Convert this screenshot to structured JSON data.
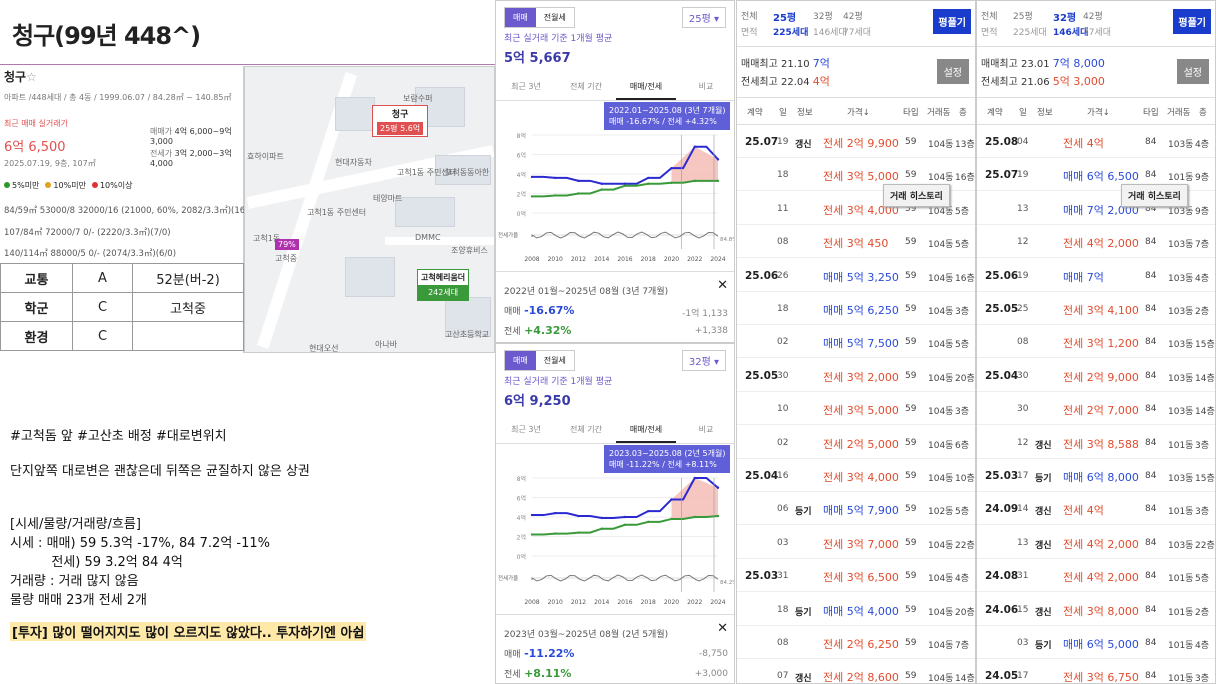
{
  "page_title": "청구(99년 448^)",
  "card": {
    "name": "청구",
    "star": "☆",
    "sub": "아파트 /448세대 / 총 4동 / 1999.06.07 / 84.28㎡ ~ 140.85㎡",
    "recent_label": "최근 매매 실거래가",
    "recent_price": "6억 6,500",
    "recent_date": "2025.07.19, 9층, 107㎡",
    "sale_label": "매매가",
    "sale_range": "4억 6,000~9억 3,000",
    "jeonse_label": "전세가",
    "jeonse_range": "3억 2,000~3억 4,000",
    "legend": [
      "5%미만",
      "10%미만",
      "10%이상"
    ],
    "legend_colors": [
      "#2a9a2a",
      "#e0a020",
      "#e03030"
    ],
    "rows": [
      "84/59㎡  53000/8  32000/16  (21000, 60%, 2082/3.3㎡)(16/2)",
      "107/84㎡  72000/7  0/-  (2220/3.3㎡)(7/0)",
      "140/114㎡  88000/5  0/-  (2074/3.3㎡)(6/0)"
    ]
  },
  "grades": [
    {
      "k": "교통",
      "g": "A",
      "v": "52분(버-2)"
    },
    {
      "k": "학군",
      "g": "C",
      "v": "고척중"
    },
    {
      "k": "환경",
      "g": "C",
      "v": ""
    }
  ],
  "map": {
    "pin_name": "청구",
    "pin_units": "25평 5.6억",
    "pin2_name": "고척헤리움더",
    "pin2_units": "242세대",
    "labels": [
      "고척1동",
      "현대자동차",
      "테양마트",
      "고척동동아한",
      "고척1동 주민센터",
      "DMMC",
      "조양휴비스",
      "고척중",
      "고산초등학교",
      "현대오선",
      "아나바",
      "보람수퍼",
      "효하이파트"
    ],
    "badge": "79%"
  },
  "notes": {
    "l1": "#고척돔 앞 #고산초 배정 #대로변위치",
    "l2": "단지앞쪽 대로변은 괜찮은데 뒤쪽은 균질하지 않은 상권",
    "l3": "[시세/물량/거래량/흐름]",
    "l4": "시세 : 매매) 59 5.3억 -17%, 84 7.2억 -11%",
    "l5": "          전세) 59 3.2억 84 4억",
    "l6": "거래량 : 거래 많지 않음",
    "l7": "물량 매매 23개 전세 2개",
    "l8": "[투자] 많이 떨어지지도 많이 오르지도 않았다.. 투자하기엔 아쉽"
  },
  "panel1": {
    "seg": [
      "매매",
      "전월세"
    ],
    "select": "25평",
    "title": "최근 실거래 기준 1개월 평균",
    "value": "5억 5,667",
    "tabs": [
      "최근 3년",
      "전체 기간",
      "매매/전세",
      "비교"
    ],
    "tip1": "2022.01~2025.08 (3년 7개월)",
    "tip2": "매매 -16.67%  /  전세 +4.32%",
    "range": "2022년 01월~2025년 08월 (3년 7개월)",
    "m_sale": "-16.67%",
    "m_sale_amt": "-1억 1,133",
    "m_rent": "+4.32%",
    "m_rent_amt": "+1,338",
    "sale_label": "매매",
    "rent_label": "전세",
    "close": "✕",
    "ylabel": "전세가율",
    "gap": "84.8%"
  },
  "panel2": {
    "seg": [
      "매매",
      "전월세"
    ],
    "select": "32평",
    "title": "최근 실거래 기준 1개월 평균",
    "value": "6억 9,250",
    "tabs": [
      "최근 3년",
      "전체 기간",
      "매매/전세",
      "비교"
    ],
    "tip1": "2023.03~2025.08 (2년 5개월)",
    "tip2": "매매 -11.22% / 전세 +8.11%",
    "range": "2023년 03월~2025년 08월 (2년 5개월)",
    "m_sale": "-11.22%",
    "m_sale_amt": "-8,750",
    "m_rent": "+8.11%",
    "m_rent_amt": "+3,000",
    "sale_label": "매매",
    "rent_label": "전세",
    "close": "✕",
    "ylabel": "전세가율",
    "gap": "84.2%"
  },
  "chart_data": [
    {
      "type": "line",
      "x": [
        "2008",
        "2010",
        "2012",
        "2014",
        "2016",
        "2018",
        "2020",
        "2022",
        "2024"
      ],
      "yticks": [
        "8억",
        "6억",
        "4억",
        "2억",
        "0억"
      ],
      "ylim": [
        0,
        8
      ],
      "series": [
        {
          "name": "매매",
          "color": "#2a2ad0",
          "values": [
            3.7,
            3.6,
            3.3,
            3.0,
            3.0,
            3.6,
            4.6,
            6.8,
            5.5
          ]
        },
        {
          "name": "전세",
          "color": "#3a9a3a",
          "values": [
            1.7,
            1.8,
            2.0,
            2.4,
            2.8,
            3.0,
            3.1,
            3.3,
            3.3
          ]
        }
      ]
    },
    {
      "type": "line",
      "x": [
        "2008",
        "2010",
        "2012",
        "2014",
        "2016",
        "2018",
        "2020",
        "2022",
        "2024"
      ],
      "yticks": [
        "8억",
        "6억",
        "4억",
        "2억",
        "0억"
      ],
      "ylim": [
        0,
        8
      ],
      "series": [
        {
          "name": "매매",
          "color": "#2a2ad0",
          "values": [
            4.2,
            4.4,
            4.1,
            3.9,
            4.0,
            4.6,
            5.8,
            8.0,
            7.0
          ]
        },
        {
          "name": "전세",
          "color": "#3a9a3a",
          "values": [
            2.2,
            2.3,
            2.4,
            2.8,
            3.2,
            3.5,
            3.8,
            4.0,
            4.1
          ]
        }
      ]
    }
  ],
  "t1": {
    "areas": [
      "전체",
      "25평",
      "32평",
      "42평"
    ],
    "units": [
      "면적",
      "225세대",
      "146세대",
      "77세대"
    ],
    "btn": "평플기",
    "btn2": "설정",
    "max1": "매매최고 21.10 ",
    "max1v": "7억",
    "max2": "전세최고 22.04 ",
    "max2v": "4억",
    "cols": [
      "계약",
      "일",
      "정보",
      "가격↓",
      "타입",
      "거래동",
      "층"
    ],
    "popup": "거래 히스토리",
    "rows": [
      {
        "ym": "25.07",
        "d": "19",
        "i": "갱신",
        "k": "rent",
        "p": "전세 2억 9,900",
        "t": "59",
        "dg": "104동",
        "f": "13층"
      },
      {
        "ym": "",
        "d": "18",
        "i": "",
        "k": "rent",
        "p": "전세 3억 5,000",
        "t": "59",
        "dg": "104동",
        "f": "16층"
      },
      {
        "ym": "",
        "d": "11",
        "i": "",
        "k": "rent",
        "p": "전세 3억 4,000",
        "t": "59",
        "dg": "104동",
        "f": "5층"
      },
      {
        "ym": "",
        "d": "08",
        "i": "",
        "k": "rent",
        "p": "전세 3억 450",
        "t": "59",
        "dg": "104동",
        "f": "5층"
      },
      {
        "ym": "25.06",
        "d": "26",
        "i": "",
        "k": "sale",
        "p": "매매 5억 3,250",
        "t": "59",
        "dg": "104동",
        "f": "16층"
      },
      {
        "ym": "",
        "d": "18",
        "i": "",
        "k": "sale",
        "p": "매매 5억 6,250",
        "t": "59",
        "dg": "104동",
        "f": "3층"
      },
      {
        "ym": "",
        "d": "02",
        "i": "",
        "k": "sale",
        "p": "매매 5억 7,500",
        "t": "59",
        "dg": "104동",
        "f": "5층"
      },
      {
        "ym": "25.05",
        "d": "30",
        "i": "",
        "k": "rent",
        "p": "전세 3억 2,000",
        "t": "59",
        "dg": "104동",
        "f": "20층"
      },
      {
        "ym": "",
        "d": "10",
        "i": "",
        "k": "rent",
        "p": "전세 3억 5,000",
        "t": "59",
        "dg": "104동",
        "f": "3층"
      },
      {
        "ym": "",
        "d": "02",
        "i": "",
        "k": "rent",
        "p": "전세 2억 5,000",
        "t": "59",
        "dg": "104동",
        "f": "6층"
      },
      {
        "ym": "25.04",
        "d": "16",
        "i": "",
        "k": "rent",
        "p": "전세 3억 4,000",
        "t": "59",
        "dg": "104동",
        "f": "10층"
      },
      {
        "ym": "",
        "d": "06",
        "i": "등기",
        "k": "sale",
        "p": "매매 5억 7,900",
        "t": "59",
        "dg": "102동",
        "f": "5층"
      },
      {
        "ym": "",
        "d": "03",
        "i": "",
        "k": "rent",
        "p": "전세 3억 7,000",
        "t": "59",
        "dg": "104동",
        "f": "22층"
      },
      {
        "ym": "25.03",
        "d": "31",
        "i": "",
        "k": "rent",
        "p": "전세 3억 6,500",
        "t": "59",
        "dg": "104동",
        "f": "4층"
      },
      {
        "ym": "",
        "d": "18",
        "i": "등기",
        "k": "sale",
        "p": "매매 5억 4,000",
        "t": "59",
        "dg": "104동",
        "f": "20층"
      },
      {
        "ym": "",
        "d": "08",
        "i": "",
        "k": "rent",
        "p": "전세 2억 6,250",
        "t": "59",
        "dg": "104동",
        "f": "7층"
      },
      {
        "ym": "",
        "d": "07",
        "i": "갱신",
        "k": "rent",
        "p": "전세 2억 8,600",
        "t": "59",
        "dg": "104동",
        "f": "14층"
      }
    ]
  },
  "t2": {
    "areas": [
      "전체",
      "25평",
      "32평",
      "42평"
    ],
    "units": [
      "면적",
      "225세대",
      "146세대",
      "77세대"
    ],
    "btn": "평플기",
    "btn2": "설정",
    "max1": "매매최고 23.01 ",
    "max1v": "7억 8,000",
    "max2": "전세최고 21.06 ",
    "max2v": "5억 3,000",
    "cols": [
      "계약",
      "일",
      "정보",
      "가격↓",
      "타입",
      "거래동",
      "층"
    ],
    "popup": "거래 히스토리",
    "rows": [
      {
        "ym": "25.08",
        "d": "04",
        "i": "",
        "k": "rent",
        "p": "전세 4억",
        "t": "84",
        "dg": "103동",
        "f": "4층"
      },
      {
        "ym": "25.07",
        "d": "19",
        "i": "",
        "k": "sale",
        "p": "매매 6억 6,500",
        "t": "84",
        "dg": "101동",
        "f": "9층"
      },
      {
        "ym": "",
        "d": "13",
        "i": "",
        "k": "sale",
        "p": "매매 7억 2,000",
        "t": "84",
        "dg": "103동",
        "f": "9층"
      },
      {
        "ym": "",
        "d": "12",
        "i": "",
        "k": "rent",
        "p": "전세 4억 2,000",
        "t": "84",
        "dg": "103동",
        "f": "7층"
      },
      {
        "ym": "25.06",
        "d": "19",
        "i": "",
        "k": "sale",
        "p": "매매 7억",
        "t": "84",
        "dg": "103동",
        "f": "4층"
      },
      {
        "ym": "25.05",
        "d": "25",
        "i": "",
        "k": "rent",
        "p": "전세 3억 4,100",
        "t": "84",
        "dg": "103동",
        "f": "2층"
      },
      {
        "ym": "",
        "d": "08",
        "i": "",
        "k": "rent",
        "p": "전세 3억 1,200",
        "t": "84",
        "dg": "103동",
        "f": "15층"
      },
      {
        "ym": "25.04",
        "d": "30",
        "i": "",
        "k": "rent",
        "p": "전세 2억 9,000",
        "t": "84",
        "dg": "103동",
        "f": "14층"
      },
      {
        "ym": "",
        "d": "30",
        "i": "",
        "k": "rent",
        "p": "전세 2억 7,000",
        "t": "84",
        "dg": "103동",
        "f": "14층"
      },
      {
        "ym": "",
        "d": "12",
        "i": "갱신",
        "k": "rent",
        "p": "전세 3억 8,588",
        "t": "84",
        "dg": "101동",
        "f": "3층"
      },
      {
        "ym": "25.03",
        "d": "17",
        "i": "등기",
        "k": "sale",
        "p": "매매 6억 8,000",
        "t": "84",
        "dg": "103동",
        "f": "15층"
      },
      {
        "ym": "24.09",
        "d": "14",
        "i": "갱신",
        "k": "rent",
        "p": "전세 4억",
        "t": "84",
        "dg": "101동",
        "f": "3층"
      },
      {
        "ym": "",
        "d": "13",
        "i": "갱신",
        "k": "rent",
        "p": "전세 4억 2,000",
        "t": "84",
        "dg": "103동",
        "f": "22층"
      },
      {
        "ym": "24.08",
        "d": "31",
        "i": "",
        "k": "rent",
        "p": "전세 4억 2,000",
        "t": "84",
        "dg": "101동",
        "f": "5층"
      },
      {
        "ym": "24.06",
        "d": "15",
        "i": "갱신",
        "k": "rent",
        "p": "전세 3억 8,000",
        "t": "84",
        "dg": "101동",
        "f": "2층"
      },
      {
        "ym": "",
        "d": "03",
        "i": "등기",
        "k": "sale",
        "p": "매매 6억 5,000",
        "t": "84",
        "dg": "101동",
        "f": "4층"
      },
      {
        "ym": "24.05",
        "d": "17",
        "i": "",
        "k": "rent",
        "p": "전세 3억 6,750",
        "t": "84",
        "dg": "101동",
        "f": "3층"
      }
    ]
  }
}
